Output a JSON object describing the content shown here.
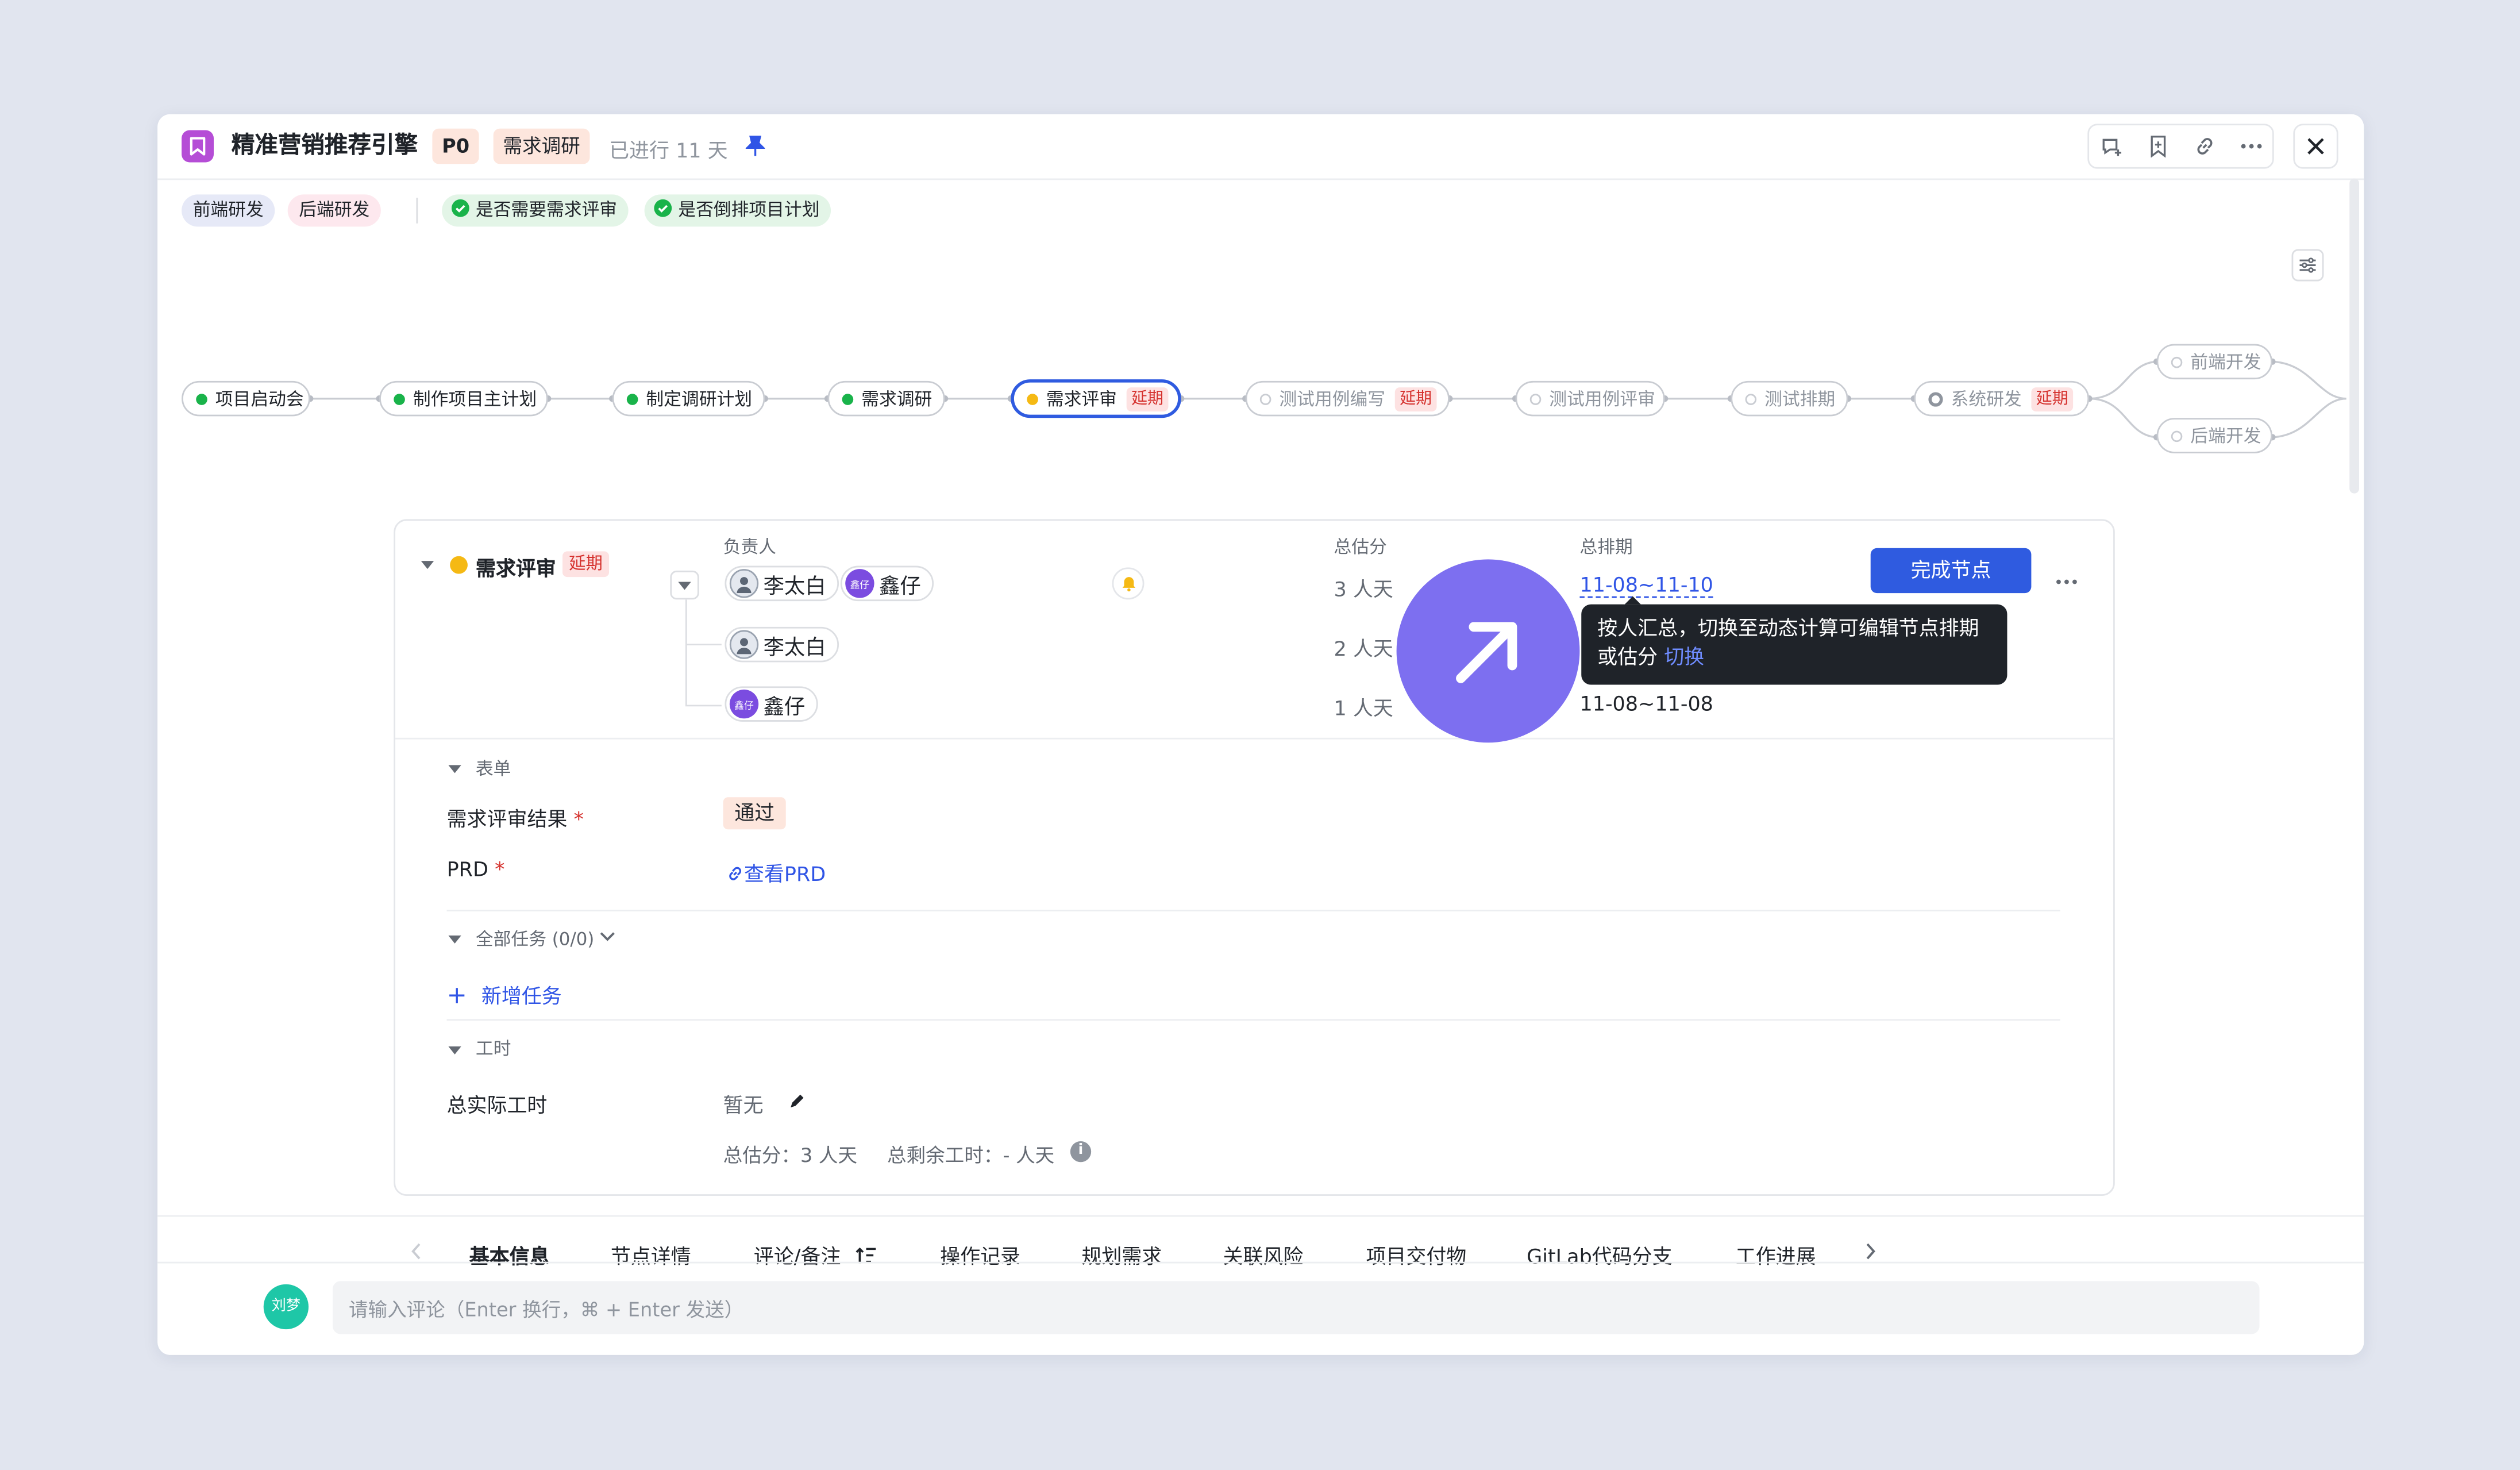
{
  "header": {
    "title": "精准营销推荐引擎",
    "priority": "P0",
    "stage": "需求调研",
    "elapsed": "已进行 11 天"
  },
  "tags": [
    "前端研发",
    "后端研发"
  ],
  "checks": [
    "是否需要需求评审",
    "是否倒排项目计划"
  ],
  "flow": {
    "delay_badge": "延期",
    "nodes": [
      {
        "label": "项目启动会"
      },
      {
        "label": "制作项目主计划"
      },
      {
        "label": "制定调研计划"
      },
      {
        "label": "需求调研"
      },
      {
        "label": "需求评审"
      },
      {
        "label": "测试用例编写"
      },
      {
        "label": "测试用例评审"
      },
      {
        "label": "测试排期"
      },
      {
        "label": "系统研发"
      },
      {
        "label": "前端开发"
      },
      {
        "label": "后端开发"
      }
    ]
  },
  "detail": {
    "node_name": "需求评审",
    "delay": "延期",
    "col_owner": "负责人",
    "col_estimate": "总估分",
    "col_schedule": "总排期",
    "people": [
      "李太白",
      "鑫仔"
    ],
    "avatar_short": "鑫仔",
    "rows": [
      {
        "estimate": "3 人天",
        "schedule": "11-08~11-10"
      },
      {
        "estimate": "2 人天",
        "schedule": ""
      },
      {
        "estimate": "1 人天",
        "schedule": "11-08~11-08"
      }
    ],
    "complete_btn": "完成节点",
    "tooltip_text": "按人汇总，切换至动态计算可编辑节点排期或估分",
    "tooltip_link": "切换"
  },
  "form": {
    "section": "表单",
    "review_label": "需求评审结果",
    "review_value": "通过",
    "prd_label": "PRD",
    "prd_link": "查看PRD",
    "required": "*"
  },
  "tasks": {
    "section": "全部任务 (0/0)",
    "add": "新增任务"
  },
  "hours": {
    "section": "工时",
    "actual_label": "总实际工时",
    "actual_value": "暂无",
    "estimate_summary": "总估分：3 人天",
    "remain_summary": "总剩余工时：- 人天"
  },
  "tabs": [
    "基本信息",
    "节点详情",
    "评论/备注",
    "操作记录",
    "规划需求",
    "关联风险",
    "项目交付物",
    "GitLab代码分支",
    "工作进展"
  ],
  "comment": {
    "user": "刘梦",
    "placeholder": "请输入评论（Enter 换行，⌘ + Enter 发送）"
  },
  "colors": {
    "primary": "#3055e6",
    "done_green": "#19b34a",
    "in_progress": "#f5b914",
    "danger": "#d5322e",
    "highlight_circle": "#7d6ff0",
    "avatar_teal": "#1ec7a7"
  }
}
